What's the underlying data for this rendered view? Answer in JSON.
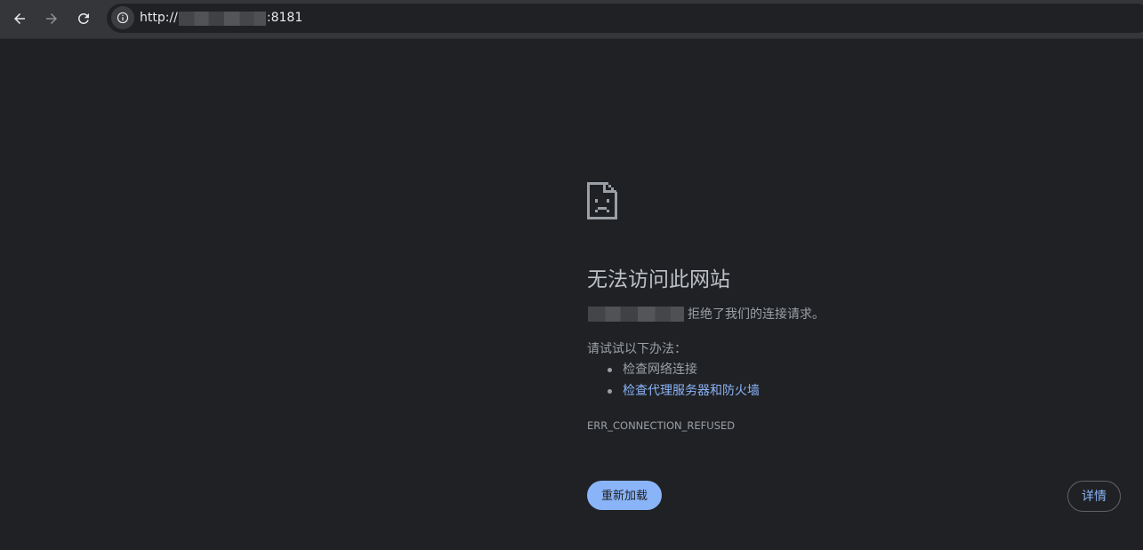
{
  "toolbar": {
    "url_scheme": "http://",
    "url_port": ":8181"
  },
  "error_page": {
    "title": "无法访问此网站",
    "description_suffix": "拒绝了我们的连接请求。",
    "try_heading": "请试试以下办法：",
    "suggestions": [
      {
        "label": "检查网络连接"
      },
      {
        "label": "检查代理服务器和防火墙"
      }
    ],
    "error_code": "ERR_CONNECTION_REFUSED",
    "reload_label": "重新加载",
    "details_label": "详情"
  },
  "colors": {
    "background": "#202124",
    "toolbar": "#35363a",
    "accent": "#8ab4f8",
    "text": "#9aa0a6",
    "title": "#bdc1c6"
  }
}
